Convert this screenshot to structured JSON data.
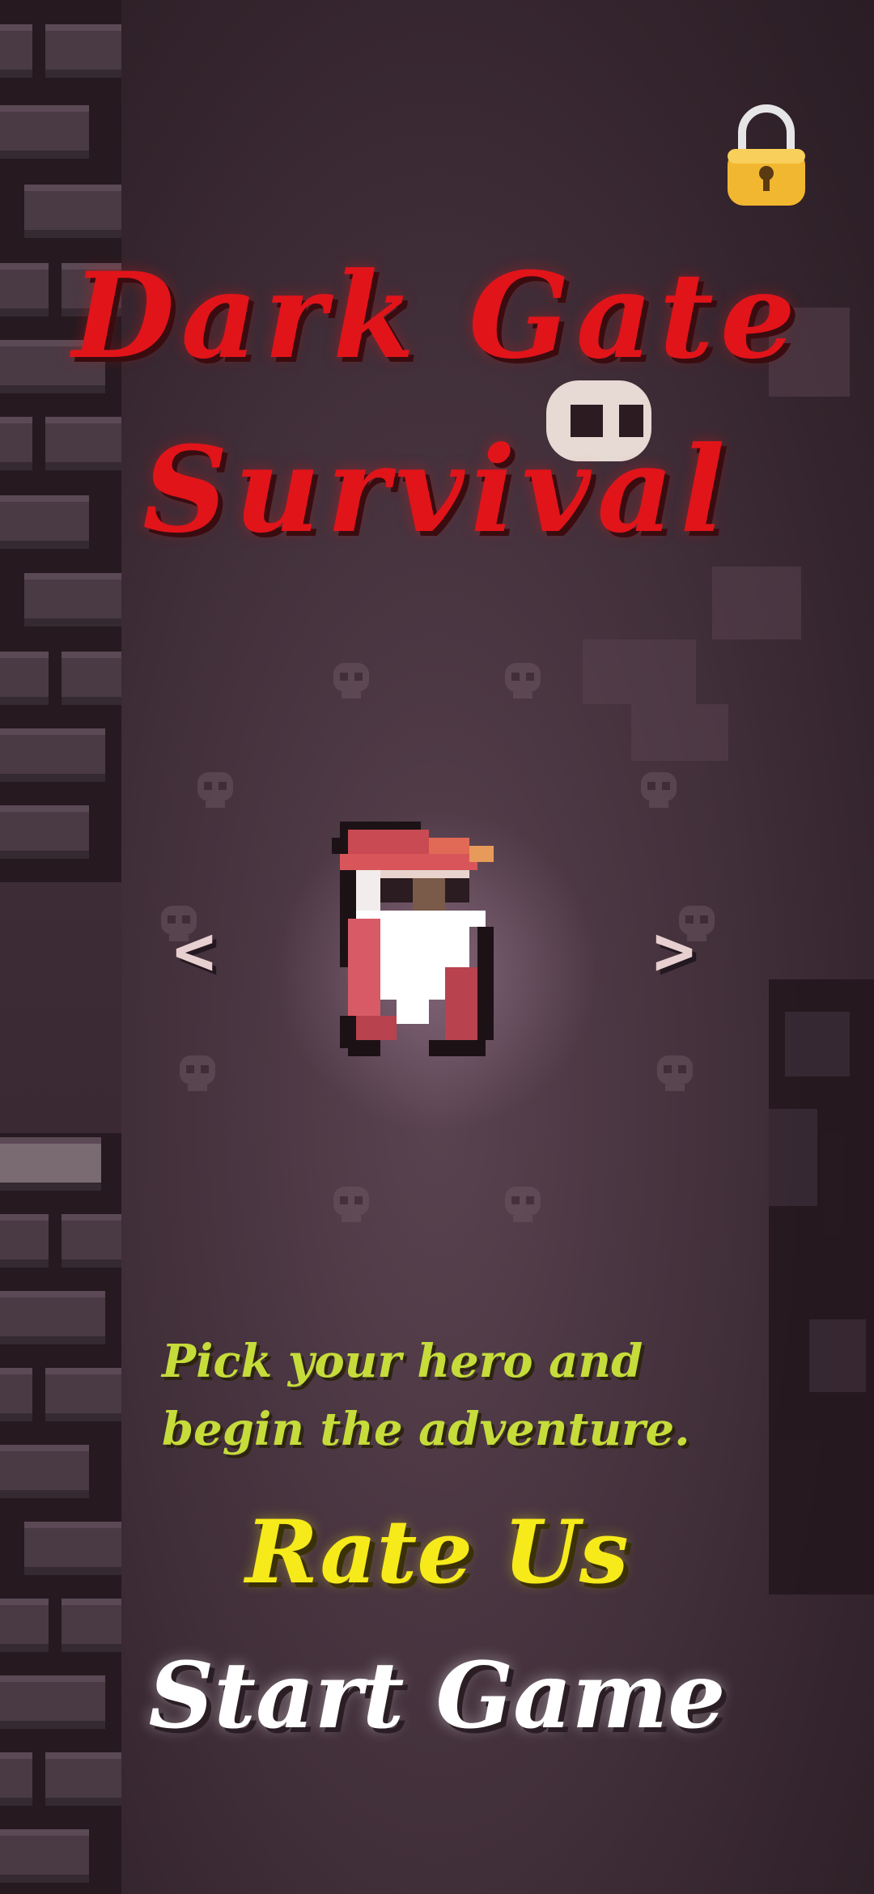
{
  "title": {
    "line1": "Dark Gate",
    "line2": "Survival"
  },
  "hero_selector": {
    "prev_label": "<",
    "next_label": ">",
    "hero": "wizard"
  },
  "description": {
    "line1": "Pick your hero and",
    "line2": "begin the adventure."
  },
  "buttons": {
    "rate_label": "Rate Us",
    "start_label": "Start Game"
  },
  "icons": {
    "lock": "lock-icon",
    "skull": "skull-icon"
  },
  "colors": {
    "title": "#e1141a",
    "rate": "#f6ea1a",
    "start": "#ffffff",
    "description": "#c6dc3a",
    "lock": "#f2b731"
  }
}
